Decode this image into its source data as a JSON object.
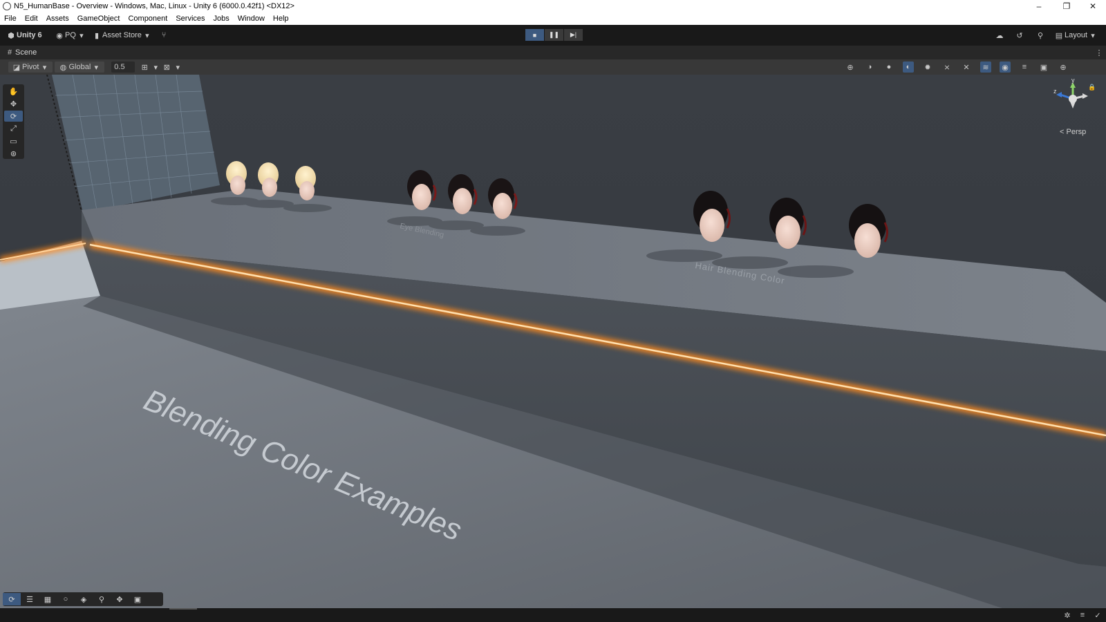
{
  "window": {
    "title": "N5_HumanBase - Overview - Windows, Mac, Linux - Unity 6 (6000.0.42f1) <DX12>",
    "controls": {
      "minimize": "–",
      "maximize": "❐",
      "close": "✕"
    }
  },
  "menu": [
    "File",
    "Edit",
    "Assets",
    "GameObject",
    "Component",
    "Services",
    "Jobs",
    "Window",
    "Help"
  ],
  "toolbar": {
    "account": "Unity 6",
    "user": "PQ",
    "asset_store": "Asset Store",
    "layout": "Layout"
  },
  "play": {
    "stop": "■",
    "pause": "❚❚",
    "step": "▶|"
  },
  "tab": {
    "label": "Scene"
  },
  "scene_toolbar": {
    "pivot": "Pivot",
    "global": "Global",
    "snap_value": "0.5"
  },
  "gizmo": {
    "persp": "Persp",
    "y_axis": "y",
    "z_axis": "z"
  },
  "scene": {
    "title_text": "Blending Color Examples",
    "label_hair": "Hair Blending Color",
    "label_eye": "Eye Blending"
  },
  "colors": {
    "accent": "#3d5a80",
    "neon": "#ff8a1f",
    "floor": "#5a5f66"
  }
}
